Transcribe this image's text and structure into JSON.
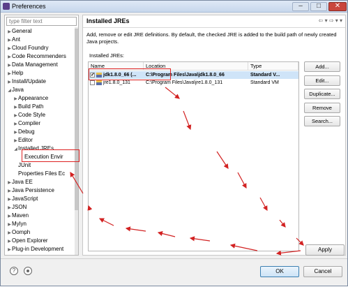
{
  "window": {
    "title": "Preferences",
    "accent": "#c9463d",
    "min_glyph": "–",
    "max_glyph": "□",
    "close_glyph": "✕"
  },
  "sidebar": {
    "filter_placeholder": "type filter text",
    "items": [
      {
        "label": "General",
        "twisty": "▶",
        "level": 0
      },
      {
        "label": "Ant",
        "twisty": "▶",
        "level": 0
      },
      {
        "label": "Cloud Foundry",
        "twisty": "▶",
        "level": 0
      },
      {
        "label": "Code Recommenders",
        "twisty": "▶",
        "level": 0
      },
      {
        "label": "Data Management",
        "twisty": "▶",
        "level": 0
      },
      {
        "label": "Help",
        "twisty": "▶",
        "level": 0
      },
      {
        "label": "Install/Update",
        "twisty": "▶",
        "level": 0
      },
      {
        "label": "Java",
        "twisty": "◢",
        "level": 0
      },
      {
        "label": "Appearance",
        "twisty": "▶",
        "level": 1
      },
      {
        "label": "Build Path",
        "twisty": "▶",
        "level": 1
      },
      {
        "label": "Code Style",
        "twisty": "▶",
        "level": 1
      },
      {
        "label": "Compiler",
        "twisty": "▶",
        "level": 1
      },
      {
        "label": "Debug",
        "twisty": "▶",
        "level": 1
      },
      {
        "label": "Editor",
        "twisty": "▶",
        "level": 1
      },
      {
        "label": "Installed JREs",
        "twisty": "◢",
        "level": 1
      },
      {
        "label": "Execution Envir",
        "twisty": "",
        "level": 2
      },
      {
        "label": "JUnit",
        "twisty": "",
        "level": 1
      },
      {
        "label": "Properties Files Ec",
        "twisty": "",
        "level": 1
      },
      {
        "label": "Java EE",
        "twisty": "▶",
        "level": 0
      },
      {
        "label": "Java Persistence",
        "twisty": "▶",
        "level": 0
      },
      {
        "label": "JavaScript",
        "twisty": "▶",
        "level": 0
      },
      {
        "label": "JSON",
        "twisty": "▶",
        "level": 0
      },
      {
        "label": "Maven",
        "twisty": "▶",
        "level": 0
      },
      {
        "label": "Mylyn",
        "twisty": "▶",
        "level": 0
      },
      {
        "label": "Oomph",
        "twisty": "▶",
        "level": 0
      },
      {
        "label": "Open Explorer",
        "twisty": "▶",
        "level": 0
      },
      {
        "label": "Plug-in Development",
        "twisty": "▶",
        "level": 0
      }
    ]
  },
  "main": {
    "title": "Installed JREs",
    "nav_icons": "⇦ ▾ ⇨ ▾ ▾",
    "description": "Add, remove or edit JRE definitions. By default, the checked JRE is added to the build path of newly created Java projects.",
    "jres_label": "Installed JREs:",
    "columns": [
      "Name",
      "Location",
      "Type"
    ],
    "rows": [
      {
        "checked": true,
        "check_glyph": "✓",
        "name": "jdk1.8.0_66 (...",
        "location": "C:\\Program Files\\Java\\jdk1.8.0_66",
        "type": "Standard V...",
        "selected": true
      },
      {
        "checked": false,
        "check_glyph": "",
        "name": "jre1.8.0_131",
        "location": "C:\\Program Files\\Java\\jre1.8.0_131",
        "type": "Standard VM",
        "selected": false
      }
    ],
    "buttons": {
      "add": "Add...",
      "edit": "Edit...",
      "duplicate": "Duplicate...",
      "remove": "Remove",
      "search": "Search...",
      "apply": "Apply"
    }
  },
  "footer": {
    "help_glyph": "?",
    "ok": "OK",
    "cancel": "Cancel"
  },
  "annotation": {
    "color": "#d22222"
  }
}
